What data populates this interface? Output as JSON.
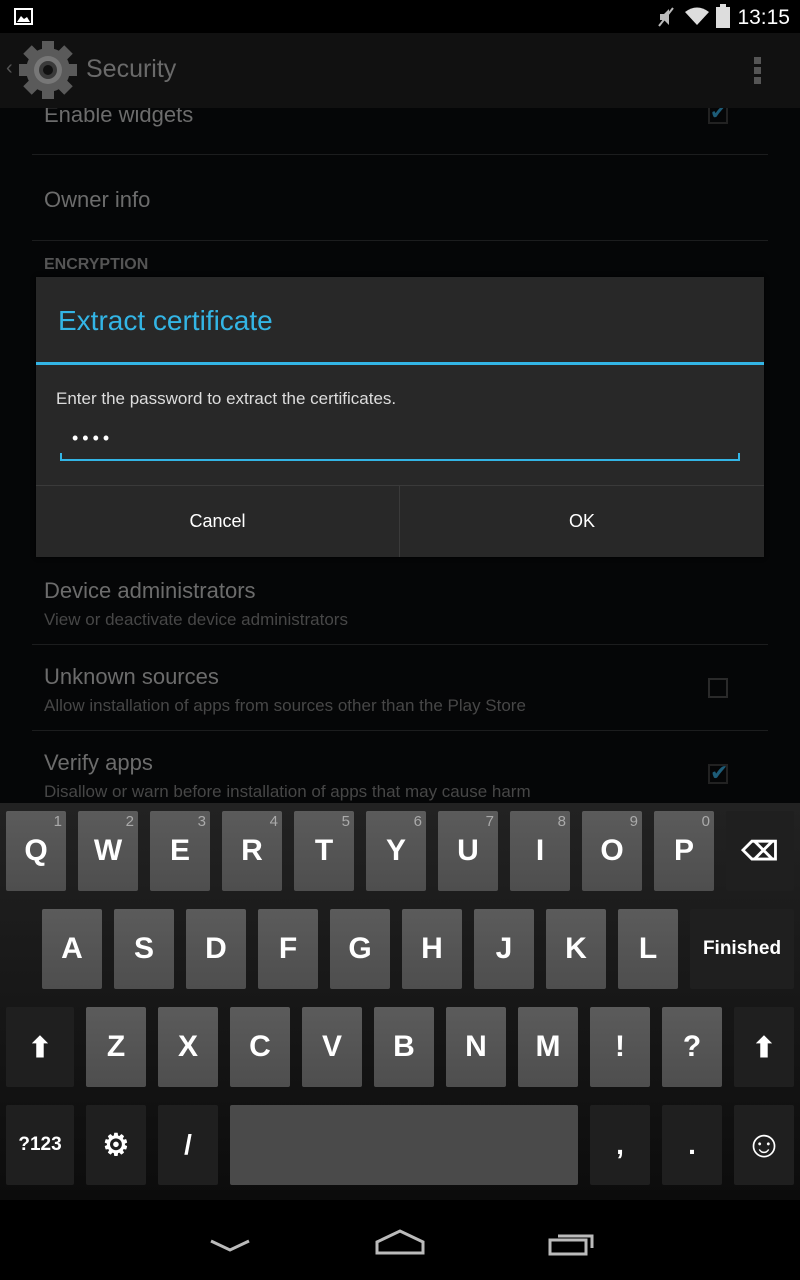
{
  "status_bar": {
    "time": "13:15",
    "icons": [
      "image-notification-icon",
      "mute-icon",
      "wifi-icon",
      "battery-icon"
    ]
  },
  "action_bar": {
    "title": "Security",
    "icon": "settings-gear-icon"
  },
  "settings": {
    "enable_widgets": {
      "title": "Enable widgets",
      "checked": true
    },
    "owner_info": {
      "title": "Owner info"
    },
    "encryption_header": "ENCRYPTION",
    "device_admins": {
      "title": "Device administrators",
      "summary": "View or deactivate device administrators"
    },
    "unknown_sources": {
      "title": "Unknown sources",
      "summary": "Allow installation of apps from sources other than the Play Store",
      "checked": false
    },
    "verify_apps": {
      "title": "Verify apps",
      "summary": "Disallow or warn before installation of apps that may cause harm",
      "checked": true
    }
  },
  "dialog": {
    "title": "Extract certificate",
    "message": "Enter the password to extract the certificates.",
    "password_value": "••••",
    "cancel_label": "Cancel",
    "ok_label": "OK",
    "accent": "#33b5e5"
  },
  "keyboard": {
    "row1": [
      [
        "Q",
        "1"
      ],
      [
        "W",
        "2"
      ],
      [
        "E",
        "3"
      ],
      [
        "R",
        "4"
      ],
      [
        "T",
        "5"
      ],
      [
        "Y",
        "6"
      ],
      [
        "U",
        "7"
      ],
      [
        "I",
        "8"
      ],
      [
        "O",
        "9"
      ],
      [
        "P",
        "0"
      ]
    ],
    "row2": [
      "A",
      "S",
      "D",
      "F",
      "G",
      "H",
      "J",
      "K",
      "L"
    ],
    "row3": [
      "Z",
      "X",
      "C",
      "V",
      "B",
      "N",
      "M",
      "!",
      "?"
    ],
    "backspace": "⌫",
    "finished": "Finished",
    "symbols": "?123",
    "slash": "/",
    "comma": ",",
    "period": ".",
    "shift": "⬆",
    "settings": "⚙",
    "emoji": "☺"
  },
  "nav_bar": {
    "icons": [
      "back-icon",
      "home-icon",
      "recents-icon"
    ]
  }
}
